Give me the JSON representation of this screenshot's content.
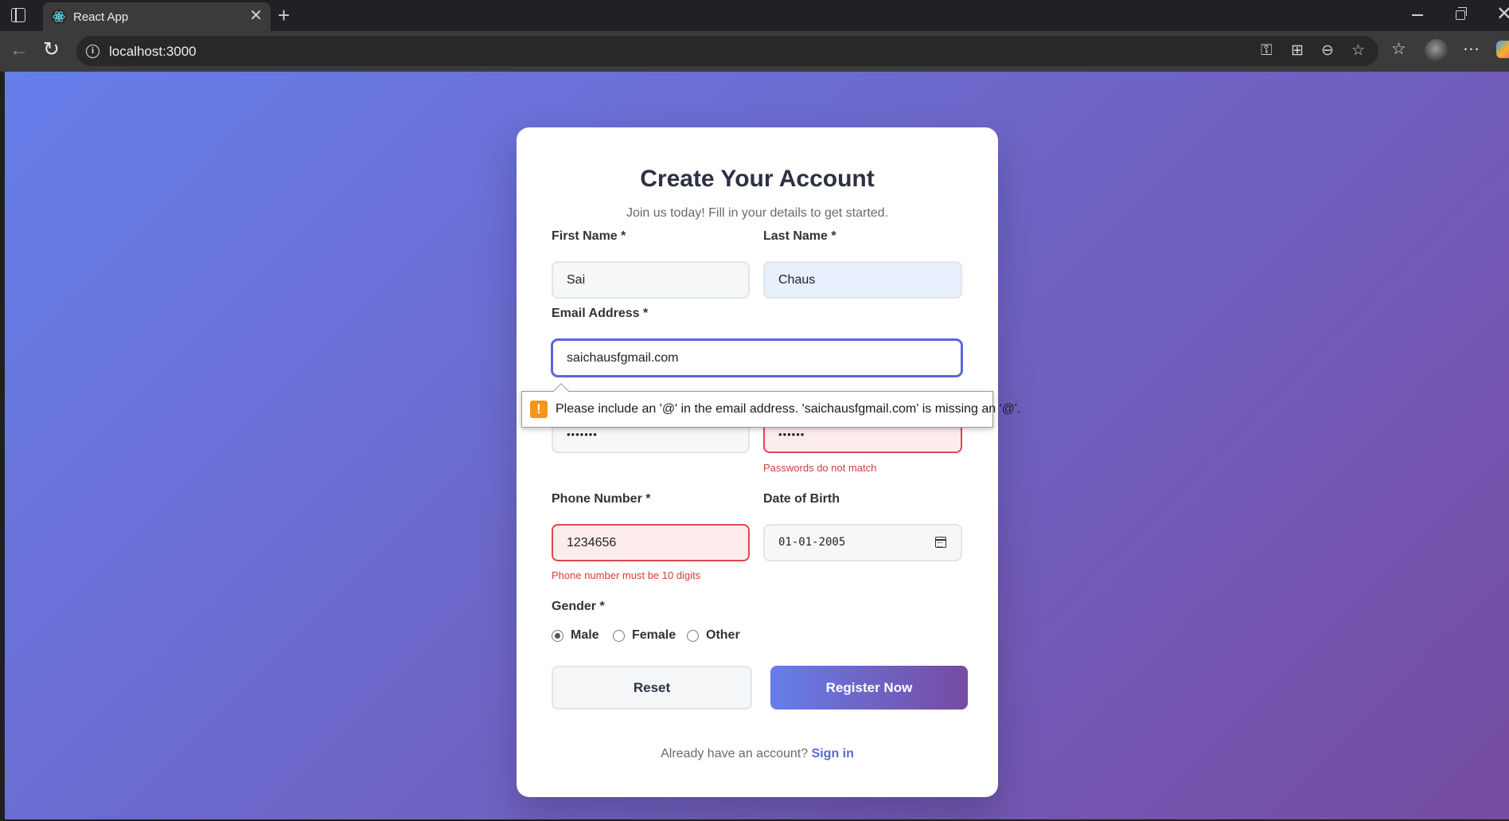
{
  "browser": {
    "tab_title": "React App",
    "url": "localhost:3000"
  },
  "form": {
    "title": "Create Your Account",
    "subtitle": "Join us today! Fill in your details to get started.",
    "first_name": {
      "label": "First Name *",
      "value": "Sai"
    },
    "last_name": {
      "label": "Last Name *",
      "value": "Chaus"
    },
    "email": {
      "label": "Email Address *",
      "value": "saichausfgmail.com"
    },
    "password": {
      "value": "•••••••"
    },
    "confirm_password": {
      "value": "••••••",
      "error": "Passwords do not match"
    },
    "phone": {
      "label": "Phone Number *",
      "value": "1234656",
      "error": "Phone number must be 10 digits"
    },
    "dob": {
      "label": "Date of Birth",
      "value": "01-01-2005"
    },
    "gender": {
      "label": "Gender *",
      "options": [
        "Male",
        "Female",
        "Other"
      ],
      "selected": "Male"
    },
    "reset_label": "Reset",
    "register_label": "Register Now",
    "footer_text": "Already have an account?",
    "footer_link": "Sign in"
  },
  "tooltip": {
    "icon": "!",
    "message": "Please include an '@' in the email address. 'saichausfgmail.com' is missing an '@'."
  },
  "colors": {
    "gradient_start": "#667eea",
    "gradient_end": "#764ba2",
    "error": "#e0464f",
    "link": "#5a67d8",
    "tooltip_icon": "#f7941d"
  }
}
